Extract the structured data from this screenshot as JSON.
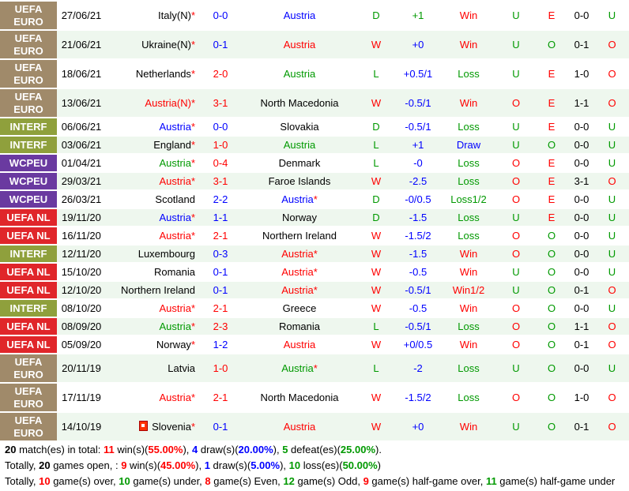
{
  "colors": {
    "uefa_euro": "#a08a6a",
    "interf": "#8fa03c",
    "wcpeu": "#6a3aa0",
    "uefa_nl": "#e0262a"
  },
  "matches": [
    {
      "comp": "UEFA EURO",
      "comp_color": "#a08a6a",
      "date": "27/06/21",
      "home": "Italy(N)",
      "home_star": true,
      "home_color": "black",
      "score": "0-0",
      "score_color": "blue",
      "away": "Austria",
      "away_star": false,
      "away_color": "blue",
      "res": "D",
      "res_color": "green",
      "hc": "+1",
      "hc_color": "green",
      "ou": "Win",
      "ou_color": "red",
      "hou": "U",
      "hou_color": "green",
      "oe": "E",
      "oe_color": "red",
      "ht": "0-0",
      "ht_color": "black",
      "hhou": "U",
      "hhou_color": "green",
      "tall": true
    },
    {
      "comp": "UEFA EURO",
      "comp_color": "#a08a6a",
      "date": "21/06/21",
      "home": "Ukraine(N)",
      "home_star": true,
      "home_color": "black",
      "score": "0-1",
      "score_color": "blue",
      "away": "Austria",
      "away_star": false,
      "away_color": "red",
      "res": "W",
      "res_color": "red",
      "hc": "+0",
      "hc_color": "blue",
      "ou": "Win",
      "ou_color": "red",
      "hou": "U",
      "hou_color": "green",
      "oe": "O",
      "oe_color": "green",
      "ht": "0-1",
      "ht_color": "black",
      "hhou": "O",
      "hhou_color": "red",
      "tall": true
    },
    {
      "comp": "UEFA EURO",
      "comp_color": "#a08a6a",
      "date": "18/06/21",
      "home": "Netherlands",
      "home_star": true,
      "home_color": "black",
      "score": "2-0",
      "score_color": "red",
      "away": "Austria",
      "away_star": false,
      "away_color": "green",
      "res": "L",
      "res_color": "green",
      "hc": "+0.5/1",
      "hc_color": "blue",
      "ou": "Loss",
      "ou_color": "green",
      "hou": "U",
      "hou_color": "green",
      "oe": "E",
      "oe_color": "red",
      "ht": "1-0",
      "ht_color": "black",
      "hhou": "O",
      "hhou_color": "red",
      "tall": true
    },
    {
      "comp": "UEFA EURO",
      "comp_color": "#a08a6a",
      "date": "13/06/21",
      "home": "Austria(N)",
      "home_star": true,
      "home_color": "red",
      "score": "3-1",
      "score_color": "red",
      "away": "North Macedonia",
      "away_star": false,
      "away_color": "black",
      "res": "W",
      "res_color": "red",
      "hc": "-0.5/1",
      "hc_color": "blue",
      "ou": "Win",
      "ou_color": "red",
      "hou": "O",
      "hou_color": "red",
      "oe": "E",
      "oe_color": "red",
      "ht": "1-1",
      "ht_color": "black",
      "hhou": "O",
      "hhou_color": "red",
      "tall": true
    },
    {
      "comp": "INTERF",
      "comp_color": "#8fa03c",
      "date": "06/06/21",
      "home": "Austria",
      "home_star": true,
      "home_color": "blue",
      "score": "0-0",
      "score_color": "blue",
      "away": "Slovakia",
      "away_star": false,
      "away_color": "black",
      "res": "D",
      "res_color": "green",
      "hc": "-0.5/1",
      "hc_color": "blue",
      "ou": "Loss",
      "ou_color": "green",
      "hou": "U",
      "hou_color": "green",
      "oe": "E",
      "oe_color": "red",
      "ht": "0-0",
      "ht_color": "black",
      "hhou": "U",
      "hhou_color": "green",
      "tall": false
    },
    {
      "comp": "INTERF",
      "comp_color": "#8fa03c",
      "date": "03/06/21",
      "home": "England",
      "home_star": true,
      "home_color": "black",
      "score": "1-0",
      "score_color": "red",
      "away": "Austria",
      "away_star": false,
      "away_color": "green",
      "res": "L",
      "res_color": "green",
      "hc": "+1",
      "hc_color": "blue",
      "ou": "Draw",
      "ou_color": "blue",
      "hou": "U",
      "hou_color": "green",
      "oe": "O",
      "oe_color": "green",
      "ht": "0-0",
      "ht_color": "black",
      "hhou": "U",
      "hhou_color": "green",
      "tall": false
    },
    {
      "comp": "WCPEU",
      "comp_color": "#6a3aa0",
      "date": "01/04/21",
      "home": "Austria",
      "home_star": true,
      "home_color": "green",
      "score": "0-4",
      "score_color": "red",
      "away": "Denmark",
      "away_star": false,
      "away_color": "black",
      "res": "L",
      "res_color": "green",
      "hc": "-0",
      "hc_color": "blue",
      "ou": "Loss",
      "ou_color": "green",
      "hou": "O",
      "hou_color": "red",
      "oe": "E",
      "oe_color": "red",
      "ht": "0-0",
      "ht_color": "black",
      "hhou": "U",
      "hhou_color": "green",
      "tall": false
    },
    {
      "comp": "WCPEU",
      "comp_color": "#6a3aa0",
      "date": "29/03/21",
      "home": "Austria",
      "home_star": true,
      "home_color": "red",
      "score": "3-1",
      "score_color": "red",
      "away": "Faroe Islands",
      "away_star": false,
      "away_color": "black",
      "res": "W",
      "res_color": "red",
      "hc": "-2.5",
      "hc_color": "blue",
      "ou": "Loss",
      "ou_color": "green",
      "hou": "O",
      "hou_color": "red",
      "oe": "E",
      "oe_color": "red",
      "ht": "3-1",
      "ht_color": "black",
      "hhou": "O",
      "hhou_color": "red",
      "tall": false
    },
    {
      "comp": "WCPEU",
      "comp_color": "#6a3aa0",
      "date": "26/03/21",
      "home": "Scotland",
      "home_star": false,
      "home_color": "black",
      "score": "2-2",
      "score_color": "blue",
      "away": "Austria",
      "away_star": true,
      "away_color": "blue",
      "res": "D",
      "res_color": "green",
      "hc": "-0/0.5",
      "hc_color": "blue",
      "ou": "Loss1/2",
      "ou_color": "green",
      "hou": "O",
      "hou_color": "red",
      "oe": "E",
      "oe_color": "red",
      "ht": "0-0",
      "ht_color": "black",
      "hhou": "U",
      "hhou_color": "green",
      "tall": false
    },
    {
      "comp": "UEFA NL",
      "comp_color": "#e0262a",
      "date": "19/11/20",
      "home": "Austria",
      "home_star": true,
      "home_color": "blue",
      "score": "1-1",
      "score_color": "blue",
      "away": "Norway",
      "away_star": false,
      "away_color": "black",
      "res": "D",
      "res_color": "green",
      "hc": "-1.5",
      "hc_color": "blue",
      "ou": "Loss",
      "ou_color": "green",
      "hou": "U",
      "hou_color": "green",
      "oe": "E",
      "oe_color": "red",
      "ht": "0-0",
      "ht_color": "black",
      "hhou": "U",
      "hhou_color": "green",
      "tall": false
    },
    {
      "comp": "UEFA NL",
      "comp_color": "#e0262a",
      "date": "16/11/20",
      "home": "Austria",
      "home_star": true,
      "home_color": "red",
      "score": "2-1",
      "score_color": "red",
      "away": "Northern Ireland",
      "away_star": false,
      "away_color": "black",
      "res": "W",
      "res_color": "red",
      "hc": "-1.5/2",
      "hc_color": "blue",
      "ou": "Loss",
      "ou_color": "green",
      "hou": "O",
      "hou_color": "red",
      "oe": "O",
      "oe_color": "green",
      "ht": "0-0",
      "ht_color": "black",
      "hhou": "U",
      "hhou_color": "green",
      "tall": false
    },
    {
      "comp": "INTERF",
      "comp_color": "#8fa03c",
      "date": "12/11/20",
      "home": "Luxembourg",
      "home_star": false,
      "home_color": "black",
      "score": "0-3",
      "score_color": "blue",
      "away": "Austria",
      "away_star": true,
      "away_color": "red",
      "res": "W",
      "res_color": "red",
      "hc": "-1.5",
      "hc_color": "blue",
      "ou": "Win",
      "ou_color": "red",
      "hou": "O",
      "hou_color": "red",
      "oe": "O",
      "oe_color": "green",
      "ht": "0-0",
      "ht_color": "black",
      "hhou": "U",
      "hhou_color": "green",
      "tall": false
    },
    {
      "comp": "UEFA NL",
      "comp_color": "#e0262a",
      "date": "15/10/20",
      "home": "Romania",
      "home_star": false,
      "home_color": "black",
      "score": "0-1",
      "score_color": "blue",
      "away": "Austria",
      "away_star": true,
      "away_color": "red",
      "res": "W",
      "res_color": "red",
      "hc": "-0.5",
      "hc_color": "blue",
      "ou": "Win",
      "ou_color": "red",
      "hou": "U",
      "hou_color": "green",
      "oe": "O",
      "oe_color": "green",
      "ht": "0-0",
      "ht_color": "black",
      "hhou": "U",
      "hhou_color": "green",
      "tall": false
    },
    {
      "comp": "UEFA NL",
      "comp_color": "#e0262a",
      "date": "12/10/20",
      "home": "Northern Ireland",
      "home_star": false,
      "home_color": "black",
      "score": "0-1",
      "score_color": "blue",
      "away": "Austria",
      "away_star": true,
      "away_color": "red",
      "res": "W",
      "res_color": "red",
      "hc": "-0.5/1",
      "hc_color": "blue",
      "ou": "Win1/2",
      "ou_color": "red",
      "hou": "U",
      "hou_color": "green",
      "oe": "O",
      "oe_color": "green",
      "ht": "0-1",
      "ht_color": "black",
      "hhou": "O",
      "hhou_color": "red",
      "tall": false
    },
    {
      "comp": "INTERF",
      "comp_color": "#8fa03c",
      "date": "08/10/20",
      "home": "Austria",
      "home_star": true,
      "home_color": "red",
      "score": "2-1",
      "score_color": "red",
      "away": "Greece",
      "away_star": false,
      "away_color": "black",
      "res": "W",
      "res_color": "red",
      "hc": "-0.5",
      "hc_color": "blue",
      "ou": "Win",
      "ou_color": "red",
      "hou": "O",
      "hou_color": "red",
      "oe": "O",
      "oe_color": "green",
      "ht": "0-0",
      "ht_color": "black",
      "hhou": "U",
      "hhou_color": "green",
      "tall": false
    },
    {
      "comp": "UEFA NL",
      "comp_color": "#e0262a",
      "date": "08/09/20",
      "home": "Austria",
      "home_star": true,
      "home_color": "green",
      "score": "2-3",
      "score_color": "red",
      "away": "Romania",
      "away_star": false,
      "away_color": "black",
      "res": "L",
      "res_color": "green",
      "hc": "-0.5/1",
      "hc_color": "blue",
      "ou": "Loss",
      "ou_color": "green",
      "hou": "O",
      "hou_color": "red",
      "oe": "O",
      "oe_color": "green",
      "ht": "1-1",
      "ht_color": "black",
      "hhou": "O",
      "hhou_color": "red",
      "tall": false
    },
    {
      "comp": "UEFA NL",
      "comp_color": "#e0262a",
      "date": "05/09/20",
      "home": "Norway",
      "home_star": true,
      "home_color": "black",
      "score": "1-2",
      "score_color": "blue",
      "away": "Austria",
      "away_star": false,
      "away_color": "red",
      "res": "W",
      "res_color": "red",
      "hc": "+0/0.5",
      "hc_color": "blue",
      "ou": "Win",
      "ou_color": "red",
      "hou": "O",
      "hou_color": "red",
      "oe": "O",
      "oe_color": "green",
      "ht": "0-1",
      "ht_color": "black",
      "hhou": "O",
      "hhou_color": "red",
      "tall": false
    },
    {
      "comp": "UEFA EURO",
      "comp_color": "#a08a6a",
      "date": "20/11/19",
      "home": "Latvia",
      "home_star": false,
      "home_color": "black",
      "score": "1-0",
      "score_color": "red",
      "away": "Austria",
      "away_star": true,
      "away_color": "green",
      "res": "L",
      "res_color": "green",
      "hc": "-2",
      "hc_color": "blue",
      "ou": "Loss",
      "ou_color": "green",
      "hou": "U",
      "hou_color": "green",
      "oe": "O",
      "oe_color": "green",
      "ht": "0-0",
      "ht_color": "black",
      "hhou": "U",
      "hhou_color": "green",
      "tall": true
    },
    {
      "comp": "UEFA EURO",
      "comp_color": "#a08a6a",
      "date": "17/11/19",
      "home": "Austria",
      "home_star": true,
      "home_color": "red",
      "score": "2-1",
      "score_color": "red",
      "away": "North Macedonia",
      "away_star": false,
      "away_color": "black",
      "res": "W",
      "res_color": "red",
      "hc": "-1.5/2",
      "hc_color": "blue",
      "ou": "Loss",
      "ou_color": "green",
      "hou": "O",
      "hou_color": "red",
      "oe": "O",
      "oe_color": "green",
      "ht": "1-0",
      "ht_color": "black",
      "hhou": "O",
      "hhou_color": "red",
      "tall": true
    },
    {
      "comp": "UEFA EURO",
      "comp_color": "#a08a6a",
      "date": "14/10/19",
      "home": "Slovenia",
      "home_star": true,
      "home_flag": true,
      "home_color": "black",
      "score": "0-1",
      "score_color": "blue",
      "away": "Austria",
      "away_star": false,
      "away_color": "red",
      "res": "W",
      "res_color": "red",
      "hc": "+0",
      "hc_color": "blue",
      "ou": "Win",
      "ou_color": "red",
      "hou": "U",
      "hou_color": "green",
      "oe": "O",
      "oe_color": "green",
      "ht": "0-1",
      "ht_color": "black",
      "hhou": "O",
      "hhou_color": "red",
      "tall": true
    }
  ],
  "summary1": {
    "count": "20",
    "t1": " match(es) in total: ",
    "wins": "11",
    "t2": " win(s)(",
    "wins_pct": "55.00%",
    "t3": "), ",
    "draws": "4",
    "t4": " draw(s)(",
    "draws_pct": "20.00%",
    "t5": "), ",
    "defeats": "5",
    "t6": " defeat(es)(",
    "defeats_pct": "25.00%",
    "t7": ")."
  },
  "summary2": {
    "t0": "Totally, ",
    "count": "20",
    "t1": " games open, : ",
    "wins": "9",
    "t2": " win(s)(",
    "wins_pct": "45.00%",
    "t3": "), ",
    "draws": "1",
    "t4": " draw(s)(",
    "draws_pct": "5.00%",
    "t5": "), ",
    "loss": "10",
    "t6": " loss(es)(",
    "loss_pct": "50.00%",
    "t7": ")"
  },
  "summary3": {
    "t0": "Totally, ",
    "over": "10",
    "t1": " game(s) over, ",
    "under": "10",
    "t2": " game(s) under, ",
    "even": "8",
    "t3": " game(s) Even, ",
    "odd": "12",
    "t4": " game(s) Odd, ",
    "hover": "9",
    "t5": " game(s) half-game over, ",
    "hunder": "11",
    "t6": " game(s) half-game under"
  }
}
